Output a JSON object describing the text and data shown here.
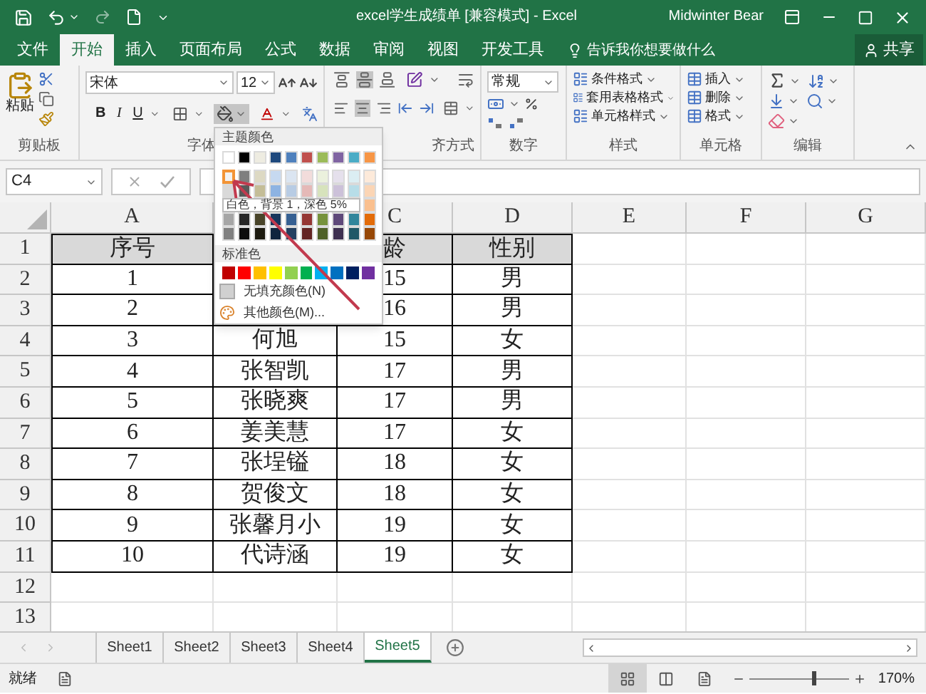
{
  "title_bar": {
    "title": "excel学生成绩单 [兼容模式] - Excel",
    "user": "Midwinter Bear"
  },
  "ribbon_tabs": [
    {
      "label": "文件",
      "selected": false
    },
    {
      "label": "开始",
      "selected": true
    },
    {
      "label": "插入",
      "selected": false
    },
    {
      "label": "页面布局",
      "selected": false
    },
    {
      "label": "公式",
      "selected": false
    },
    {
      "label": "数据",
      "selected": false
    },
    {
      "label": "审阅",
      "selected": false
    },
    {
      "label": "视图",
      "selected": false
    },
    {
      "label": "开发工具",
      "selected": false
    }
  ],
  "tell_me": "告诉我你想要做什么",
  "share": "共享",
  "ribbon": {
    "clipboard": {
      "paste": "粘贴",
      "label": "剪贴板"
    },
    "font": {
      "name": "宋体",
      "size": "12",
      "bold": "B",
      "italic": "I",
      "underline": "U",
      "label": "字体"
    },
    "alignment": {
      "label": "齐方式"
    },
    "number": {
      "format": "常规",
      "label": "数字"
    },
    "styles": {
      "items": [
        "条件格式",
        "套用表格格式",
        "单元格样式"
      ],
      "label": "样式"
    },
    "cells": {
      "items": [
        "插入",
        "删除",
        "格式"
      ],
      "label": "单元格"
    },
    "editing": {
      "label": "编辑"
    }
  },
  "formula_bar": {
    "name_box": "C4"
  },
  "columns": [
    "A",
    null,
    "C",
    "D",
    "E",
    "F",
    "G"
  ],
  "header_row": {
    "number": "1",
    "cells": {
      "a": "序号",
      "c": "龄",
      "d": "性别"
    }
  },
  "rows": [
    {
      "number": "2",
      "cells": {
        "a": "1",
        "c": "15",
        "d": "男"
      }
    },
    {
      "number": "3",
      "cells": {
        "a": "2",
        "c": "16",
        "d": "男"
      }
    },
    {
      "number": "4",
      "cells": {
        "a": "3",
        "b": "何旭",
        "c": "15",
        "d": "女"
      }
    },
    {
      "number": "5",
      "cells": {
        "a": "4",
        "b": "张智凯",
        "c": "17",
        "d": "男"
      }
    },
    {
      "number": "6",
      "cells": {
        "a": "5",
        "b": "张晓爽",
        "c": "17",
        "d": "男"
      }
    },
    {
      "number": "7",
      "cells": {
        "a": "6",
        "b": "姜美慧",
        "c": "17",
        "d": "女"
      }
    },
    {
      "number": "8",
      "cells": {
        "a": "7",
        "b": "张埕镒",
        "c": "18",
        "d": "女"
      }
    },
    {
      "number": "9",
      "cells": {
        "a": "8",
        "b": "贺俊文",
        "c": "18",
        "d": "女"
      }
    },
    {
      "number": "10",
      "cells": {
        "a": "9",
        "b": "张馨月小",
        "c": "19",
        "d": "女"
      }
    },
    {
      "number": "11",
      "cells": {
        "a": "10",
        "b": "代诗涵",
        "c": "19",
        "d": "女"
      }
    },
    {
      "number": "12"
    },
    {
      "number": "13"
    }
  ],
  "fill_menu": {
    "theme_title": "主题颜色",
    "theme_colors": [
      {
        "color": "#ffffff",
        "selected": false,
        "shades": [
          {
            "color": "#f2f2f2",
            "selected": true
          },
          {
            "color": "#d9d9d9",
            "selected": false
          },
          {
            "color": "#a6a6a6",
            "selected": false
          },
          {
            "color": "#808080",
            "selected": false
          }
        ]
      },
      {
        "color": "#000000",
        "selected": false,
        "shades": [
          {
            "color": "#7f7f7f",
            "selected": false
          },
          {
            "color": "#595959",
            "selected": false
          },
          {
            "color": "#262626",
            "selected": false
          },
          {
            "color": "#0d0d0d",
            "selected": false
          }
        ]
      },
      {
        "color": "#eeece1",
        "selected": false,
        "shades": [
          {
            "color": "#ddd9c3",
            "selected": false
          },
          {
            "color": "#c4bd97",
            "selected": false
          },
          {
            "color": "#494429",
            "selected": false
          },
          {
            "color": "#1d1b10",
            "selected": false
          }
        ]
      },
      {
        "color": "#1f497d",
        "selected": false,
        "shades": [
          {
            "color": "#c6d9f0",
            "selected": false
          },
          {
            "color": "#8db3e2",
            "selected": false
          },
          {
            "color": "#17365d",
            "selected": false
          },
          {
            "color": "#0f243e",
            "selected": false
          }
        ]
      },
      {
        "color": "#4f81bd",
        "selected": false,
        "shades": [
          {
            "color": "#dbe5f1",
            "selected": false
          },
          {
            "color": "#b8cce4",
            "selected": false
          },
          {
            "color": "#366092",
            "selected": false
          },
          {
            "color": "#244061",
            "selected": false
          }
        ]
      },
      {
        "color": "#c0504d",
        "selected": false,
        "shades": [
          {
            "color": "#f2dcdb",
            "selected": false
          },
          {
            "color": "#e5b9b7",
            "selected": false
          },
          {
            "color": "#953734",
            "selected": false
          },
          {
            "color": "#632423",
            "selected": false
          }
        ]
      },
      {
        "color": "#9bbb59",
        "selected": false,
        "shades": [
          {
            "color": "#ebf1dd",
            "selected": false
          },
          {
            "color": "#d7e3bc",
            "selected": false
          },
          {
            "color": "#76923c",
            "selected": false
          },
          {
            "color": "#4f6128",
            "selected": false
          }
        ]
      },
      {
        "color": "#8064a2",
        "selected": false,
        "shades": [
          {
            "color": "#e5e0ec",
            "selected": false
          },
          {
            "color": "#ccc1d9",
            "selected": false
          },
          {
            "color": "#5f497a",
            "selected": false
          },
          {
            "color": "#3f3151",
            "selected": false
          }
        ]
      },
      {
        "color": "#4bacc6",
        "selected": false,
        "shades": [
          {
            "color": "#dbeef3",
            "selected": false
          },
          {
            "color": "#b7dde8",
            "selected": false
          },
          {
            "color": "#31859b",
            "selected": false
          },
          {
            "color": "#205867",
            "selected": false
          }
        ]
      },
      {
        "color": "#f79646",
        "selected": false,
        "shades": [
          {
            "color": "#fdeada",
            "selected": false
          },
          {
            "color": "#fbd5b5",
            "selected": false
          },
          {
            "color": "#fac08f",
            "selected": false
          },
          {
            "color": "#e36c09",
            "selected": false
          },
          {
            "color": "#974806",
            "selected": false
          }
        ]
      }
    ],
    "tooltip": "白色，背景 1，深色 5%",
    "standard_title": "标准色",
    "standard_colors": [
      {
        "color": "#c00000"
      },
      {
        "color": "#ff0000"
      },
      {
        "color": "#ffc000"
      },
      {
        "color": "#ffff00"
      },
      {
        "color": "#92d050"
      },
      {
        "color": "#00b050"
      },
      {
        "color": "#00b0f0"
      },
      {
        "color": "#0070c0"
      },
      {
        "color": "#002060"
      },
      {
        "color": "#7030a0"
      }
    ],
    "no_fill": "无填充颜色(N)",
    "more_colors": "其他颜色(M)..."
  },
  "sheet_tabs": [
    {
      "label": "Sheet1",
      "selected": false
    },
    {
      "label": "Sheet2",
      "selected": false
    },
    {
      "label": "Sheet3",
      "selected": false
    },
    {
      "label": "Sheet4",
      "selected": false
    },
    {
      "label": "Sheet5",
      "selected": true
    }
  ],
  "status_bar": {
    "status": "就绪",
    "views": [
      {
        "kind": "normal",
        "selected": true
      },
      {
        "kind": "page_layout",
        "selected": false
      },
      {
        "kind": "page_break",
        "selected": false
      }
    ],
    "zoom": {
      "level": 0.63
    },
    "zoom_text": "170%"
  }
}
